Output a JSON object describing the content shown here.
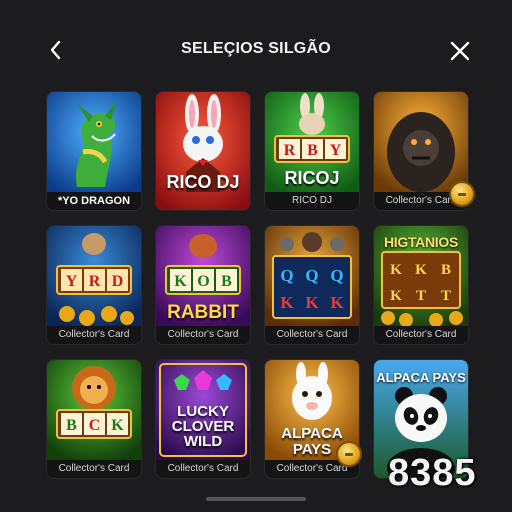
{
  "header": {
    "title": "SELEÇIOS SILGÃO",
    "back_icon": "chevron-left-icon",
    "close_icon": "close-icon"
  },
  "colors": {
    "background": "#1c1c1e",
    "caption_bg": "#141414",
    "coin": "#e0a21a"
  },
  "cards": [
    {
      "caption": "*YO DRAGON",
      "art_text": "",
      "theme": "dragon",
      "icon": "dragon-icon"
    },
    {
      "caption": "",
      "art_text": "RICO DJ",
      "theme": "rabbit",
      "icon": "rabbit-icon"
    },
    {
      "caption": "RICO DJ",
      "art_text": "RICOJ",
      "reels": "RBY",
      "theme": "rabbit-slot",
      "icon": "rabbit-icon"
    },
    {
      "caption": "Collector's Card",
      "art_text": "",
      "theme": "gorilla",
      "icon": "gorilla-icon"
    },
    {
      "caption": "Collector's Card",
      "art_text": "",
      "reels": "YRD",
      "theme": "pirate-slot",
      "icon": "slot-machine-icon"
    },
    {
      "caption": "Collector's Card",
      "art_text": "RABBIT",
      "reels": "KOB",
      "theme": "purple-slot",
      "icon": "slot-machine-icon"
    },
    {
      "caption": "Collector's Card",
      "art_text": "",
      "reels": "QQQKKK",
      "theme": "monkey-slot",
      "icon": "slot-machine-icon"
    },
    {
      "caption": "Collector's Card",
      "art_text": "HIGTANIOS",
      "reels": "KKBKTT",
      "theme": "gold-slot",
      "icon": "slot-machine-icon"
    },
    {
      "caption": "Collector's Card",
      "art_text": "",
      "reels": "BCK",
      "theme": "lion-slot",
      "icon": "lion-icon"
    },
    {
      "caption": "Collector's Card",
      "art_text": "LUCKY CLOVER WILD",
      "theme": "clover",
      "icon": "gem-icon"
    },
    {
      "caption": "Collector's Card",
      "art_text": "ALPACA PAYS",
      "theme": "alpaca",
      "icon": "alpaca-icon"
    },
    {
      "caption": "",
      "art_text": "ALPACA PAYS",
      "theme": "panda",
      "icon": "panda-icon"
    }
  ],
  "watermark": "8385"
}
